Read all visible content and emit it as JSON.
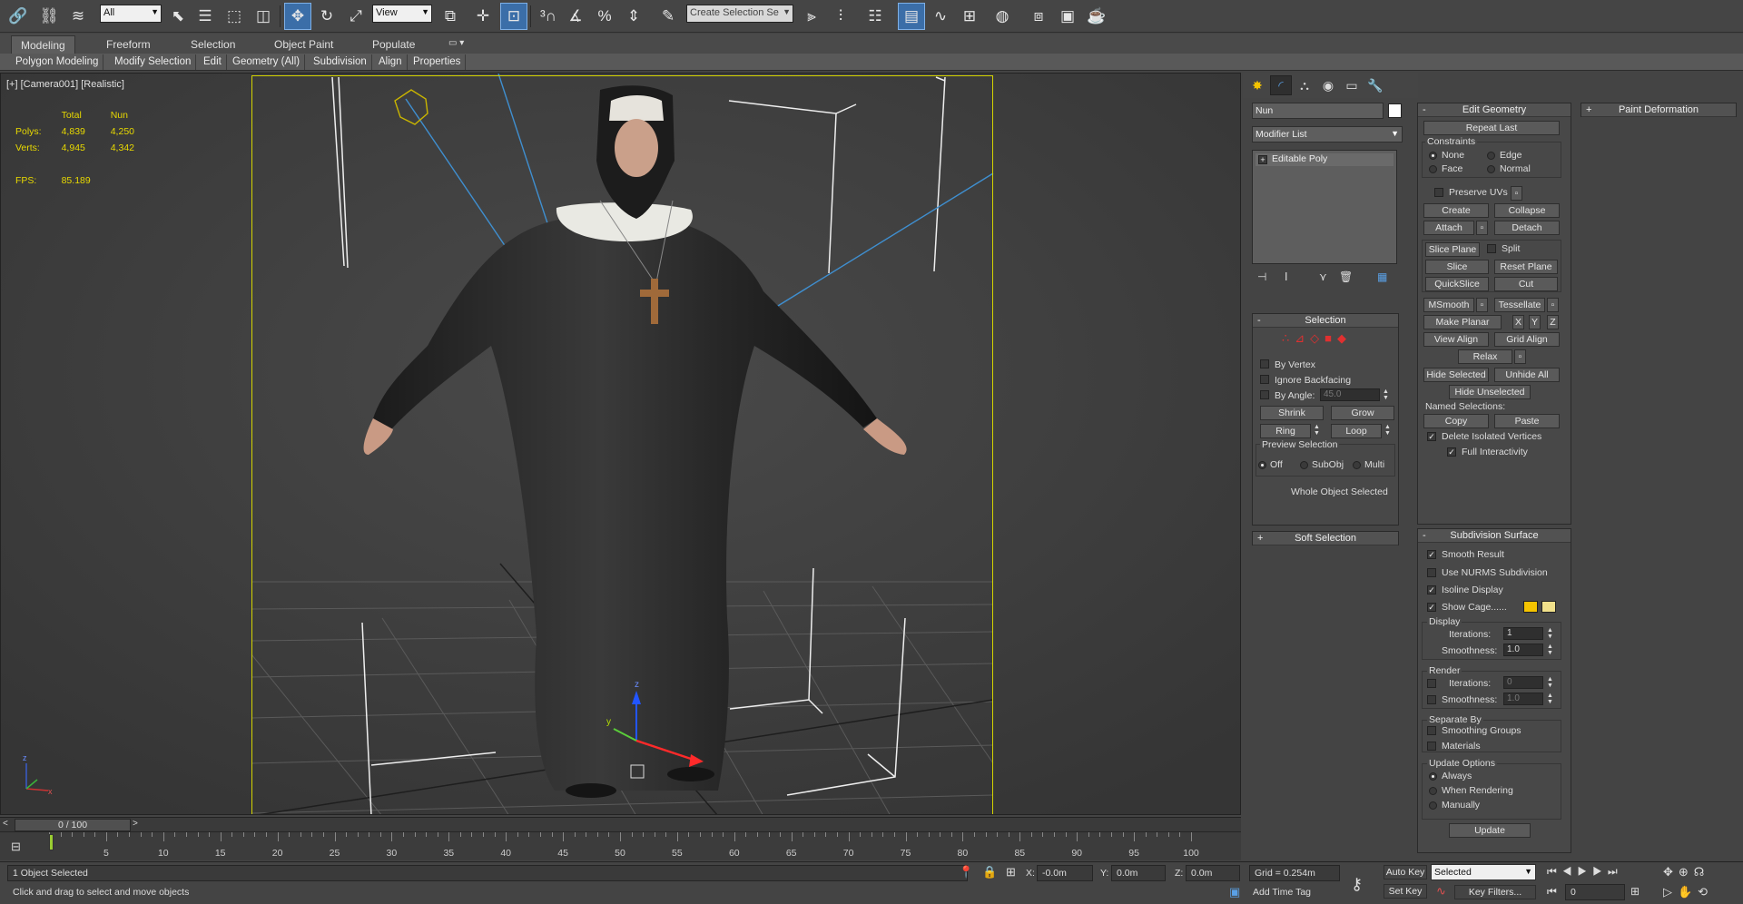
{
  "toolbar": {
    "selection_filter": "All",
    "reference_coord": "View",
    "named_selection_placeholder": "Create Selection Se"
  },
  "ribbon": {
    "tabs": [
      "Modeling",
      "Freeform",
      "Selection",
      "Object Paint",
      "Populate"
    ],
    "active_tab": "Modeling",
    "sub_tabs": [
      "Polygon Modeling",
      "Modify Selection",
      "Edit",
      "Geometry (All)",
      "Subdivision",
      "Align",
      "Properties"
    ]
  },
  "viewport": {
    "label": "[+] [Camera001] [Realistic]",
    "stats": {
      "col_total": "Total",
      "col_object": "Nun",
      "polys_label": "Polys:",
      "polys_total": "4,839",
      "polys_object": "4,250",
      "verts_label": "Verts:",
      "verts_total": "4,945",
      "verts_object": "4,342",
      "fps_label": "FPS:",
      "fps_value": "85.189"
    },
    "gizmo_labels": {
      "z": "z",
      "y": "y",
      "x": "x"
    }
  },
  "modify_panel": {
    "object_name": "Nun",
    "object_color": "#ffffff",
    "modifier_list": "Modifier List",
    "stack_item": "Editable Poly",
    "selection": {
      "title": "Selection",
      "by_vertex": "By Vertex",
      "ignore_backfacing": "Ignore Backfacing",
      "by_angle": "By Angle:",
      "by_angle_value": "45.0",
      "shrink": "Shrink",
      "grow": "Grow",
      "ring": "Ring",
      "loop": "Loop",
      "preview_title": "Preview Selection",
      "preview_off": "Off",
      "preview_subobj": "SubObj",
      "preview_multi": "Multi",
      "status": "Whole Object Selected"
    },
    "soft_selection": "Soft Selection"
  },
  "edit_geometry": {
    "title": "Edit Geometry",
    "repeat_last": "Repeat Last",
    "constraints": "Constraints",
    "c_none": "None",
    "c_edge": "Edge",
    "c_face": "Face",
    "c_normal": "Normal",
    "preserve_uvs": "Preserve UVs",
    "create": "Create",
    "collapse": "Collapse",
    "attach": "Attach",
    "detach": "Detach",
    "slice_plane": "Slice Plane",
    "split": "Split",
    "slice": "Slice",
    "reset_plane": "Reset Plane",
    "quickslice": "QuickSlice",
    "cut": "Cut",
    "msmooth": "MSmooth",
    "tessellate": "Tessellate",
    "make_planar": "Make Planar",
    "x": "X",
    "y": "Y",
    "z": "Z",
    "view_align": "View Align",
    "grid_align": "Grid Align",
    "relax": "Relax",
    "hide_selected": "Hide Selected",
    "unhide_all": "Unhide All",
    "hide_unselected": "Hide Unselected",
    "named_selections": "Named Selections:",
    "copy": "Copy",
    "paste": "Paste",
    "delete_isolated": "Delete Isolated Vertices",
    "full_interactivity": "Full Interactivity"
  },
  "subdivision": {
    "title": "Subdivision Surface",
    "smooth_result": "Smooth Result",
    "use_nurms": "Use NURMS Subdivision",
    "isoline": "Isoline Display",
    "show_cage": "Show Cage......",
    "cage_color_1": "#f5c400",
    "cage_color_2": "#f0e08a",
    "display": "Display",
    "iterations": "Iterations:",
    "iterations_value": "1",
    "smoothness": "Smoothness:",
    "smoothness_value": "1.0",
    "render": "Render",
    "r_iterations_value": "0",
    "r_smoothness_value": "1.0",
    "separate_by": "Separate By",
    "smoothing_groups": "Smoothing Groups",
    "materials": "Materials",
    "update_options": "Update Options",
    "always": "Always",
    "when_rendering": "When Rendering",
    "manually": "Manually",
    "update": "Update"
  },
  "paint_deformation": "Paint Deformation",
  "timeline": {
    "frame": "0 / 100",
    "ticks": [
      "5",
      "10",
      "15",
      "20",
      "25",
      "30",
      "35",
      "40",
      "45",
      "50",
      "55",
      "60",
      "65",
      "70",
      "75",
      "80",
      "85",
      "90",
      "95",
      "100"
    ]
  },
  "status": {
    "selected": "1 Object Selected",
    "prompt": "Click and drag to select and move objects",
    "x_label": "X:",
    "x_value": "-0.0m",
    "y_label": "Y:",
    "y_value": "0.0m",
    "z_label": "Z:",
    "z_value": "0.0m",
    "grid": "Grid = 0.254m",
    "add_time_tag": "Add Time Tag",
    "auto_key": "Auto Key",
    "set_key": "Set Key",
    "key_mode": "Selected",
    "key_filters": "Key Filters...",
    "current_frame": "0"
  }
}
